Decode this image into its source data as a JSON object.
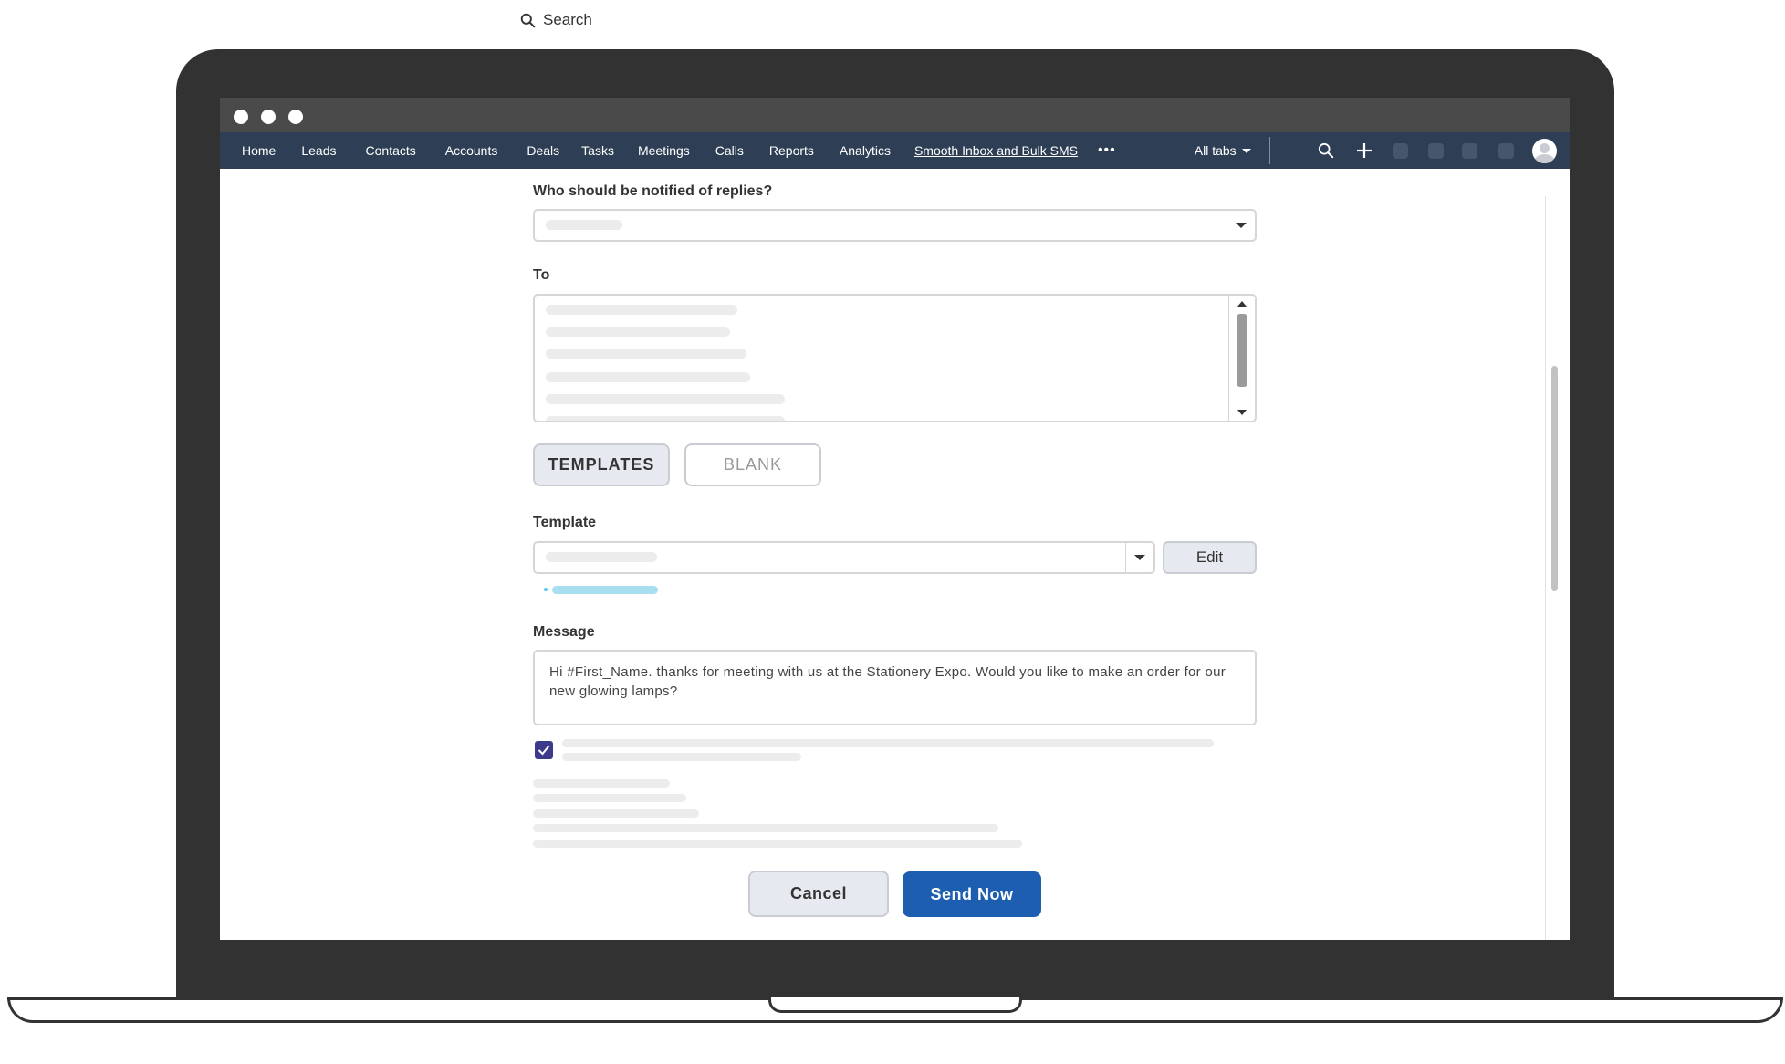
{
  "top_search": {
    "label": "Search",
    "icon": "search-icon"
  },
  "nav": {
    "items": [
      {
        "label": "Home"
      },
      {
        "label": "Leads"
      },
      {
        "label": "Contacts"
      },
      {
        "label": "Accounts"
      },
      {
        "label": "Deals"
      },
      {
        "label": "Tasks"
      },
      {
        "label": "Meetings"
      },
      {
        "label": "Calls"
      },
      {
        "label": "Reports"
      },
      {
        "label": "Analytics"
      },
      {
        "label": "Smooth Inbox and Bulk SMS"
      }
    ],
    "more": "•••",
    "all_tabs": "All tabs",
    "colors": {
      "bar": "#2e3f55",
      "active_button": "#1e5eb0"
    }
  },
  "form": {
    "notify_label": "Who should be notified of replies?",
    "to_label": "To",
    "templates_tab": "TEMPLATES",
    "blank_tab": "BLANK",
    "template_label": "Template",
    "edit_button": "Edit",
    "message_label": "Message",
    "message_text": "Hi #First_Name. thanks for meeting with us at the Stationery Expo. Would you like to make an order for our new glowing lamps?",
    "checkbox_checked": true,
    "cancel_button": "Cancel",
    "send_button": "Send Now"
  }
}
